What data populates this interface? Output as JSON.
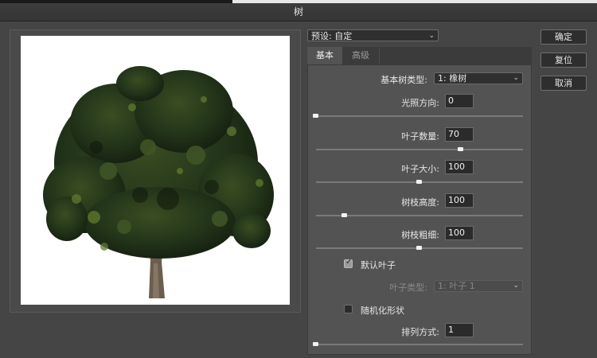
{
  "window": {
    "title": "树"
  },
  "preset": {
    "label": "预设:",
    "value": "自定"
  },
  "tabs": [
    {
      "label": "基本",
      "active": true
    },
    {
      "label": "高级",
      "active": false
    }
  ],
  "basic": {
    "tree_type": {
      "label": "基本树类型:",
      "value": "1: 橡树"
    },
    "light_direction": {
      "label": "光照方向:",
      "value": "0",
      "slider_fraction": 0.0
    },
    "leaf_count": {
      "label": "叶子数量:",
      "value": "70",
      "slider_fraction": 0.7
    },
    "leaf_size": {
      "label": "叶子大小:",
      "value": "100",
      "slider_fraction": 0.5
    },
    "branch_height": {
      "label": "树枝高度:",
      "value": "100",
      "slider_fraction": 0.14
    },
    "branch_thickness": {
      "label": "树枝粗细:",
      "value": "100",
      "slider_fraction": 0.5
    },
    "default_leaves": {
      "label": "默认叶子",
      "checked": true
    },
    "leaf_type": {
      "label": "叶子类型:",
      "value": "1: 叶子 1",
      "disabled": true
    },
    "randomize_shape": {
      "label": "随机化形状",
      "checked": false
    },
    "arrangement": {
      "label": "排列方式:",
      "value": "1",
      "slider_fraction": 0.0
    }
  },
  "buttons": {
    "ok": "确定",
    "reset": "复位",
    "cancel": "取消"
  },
  "colors": {
    "dialog_bg": "#454545",
    "panel_bg": "#535353",
    "foliage_dark": "#1f2d16",
    "foliage_mid": "#3a4d22",
    "foliage_light": "#5f7a2e",
    "trunk": "#6b5e4e"
  },
  "preview": {
    "icon": "oak-tree-preview"
  }
}
